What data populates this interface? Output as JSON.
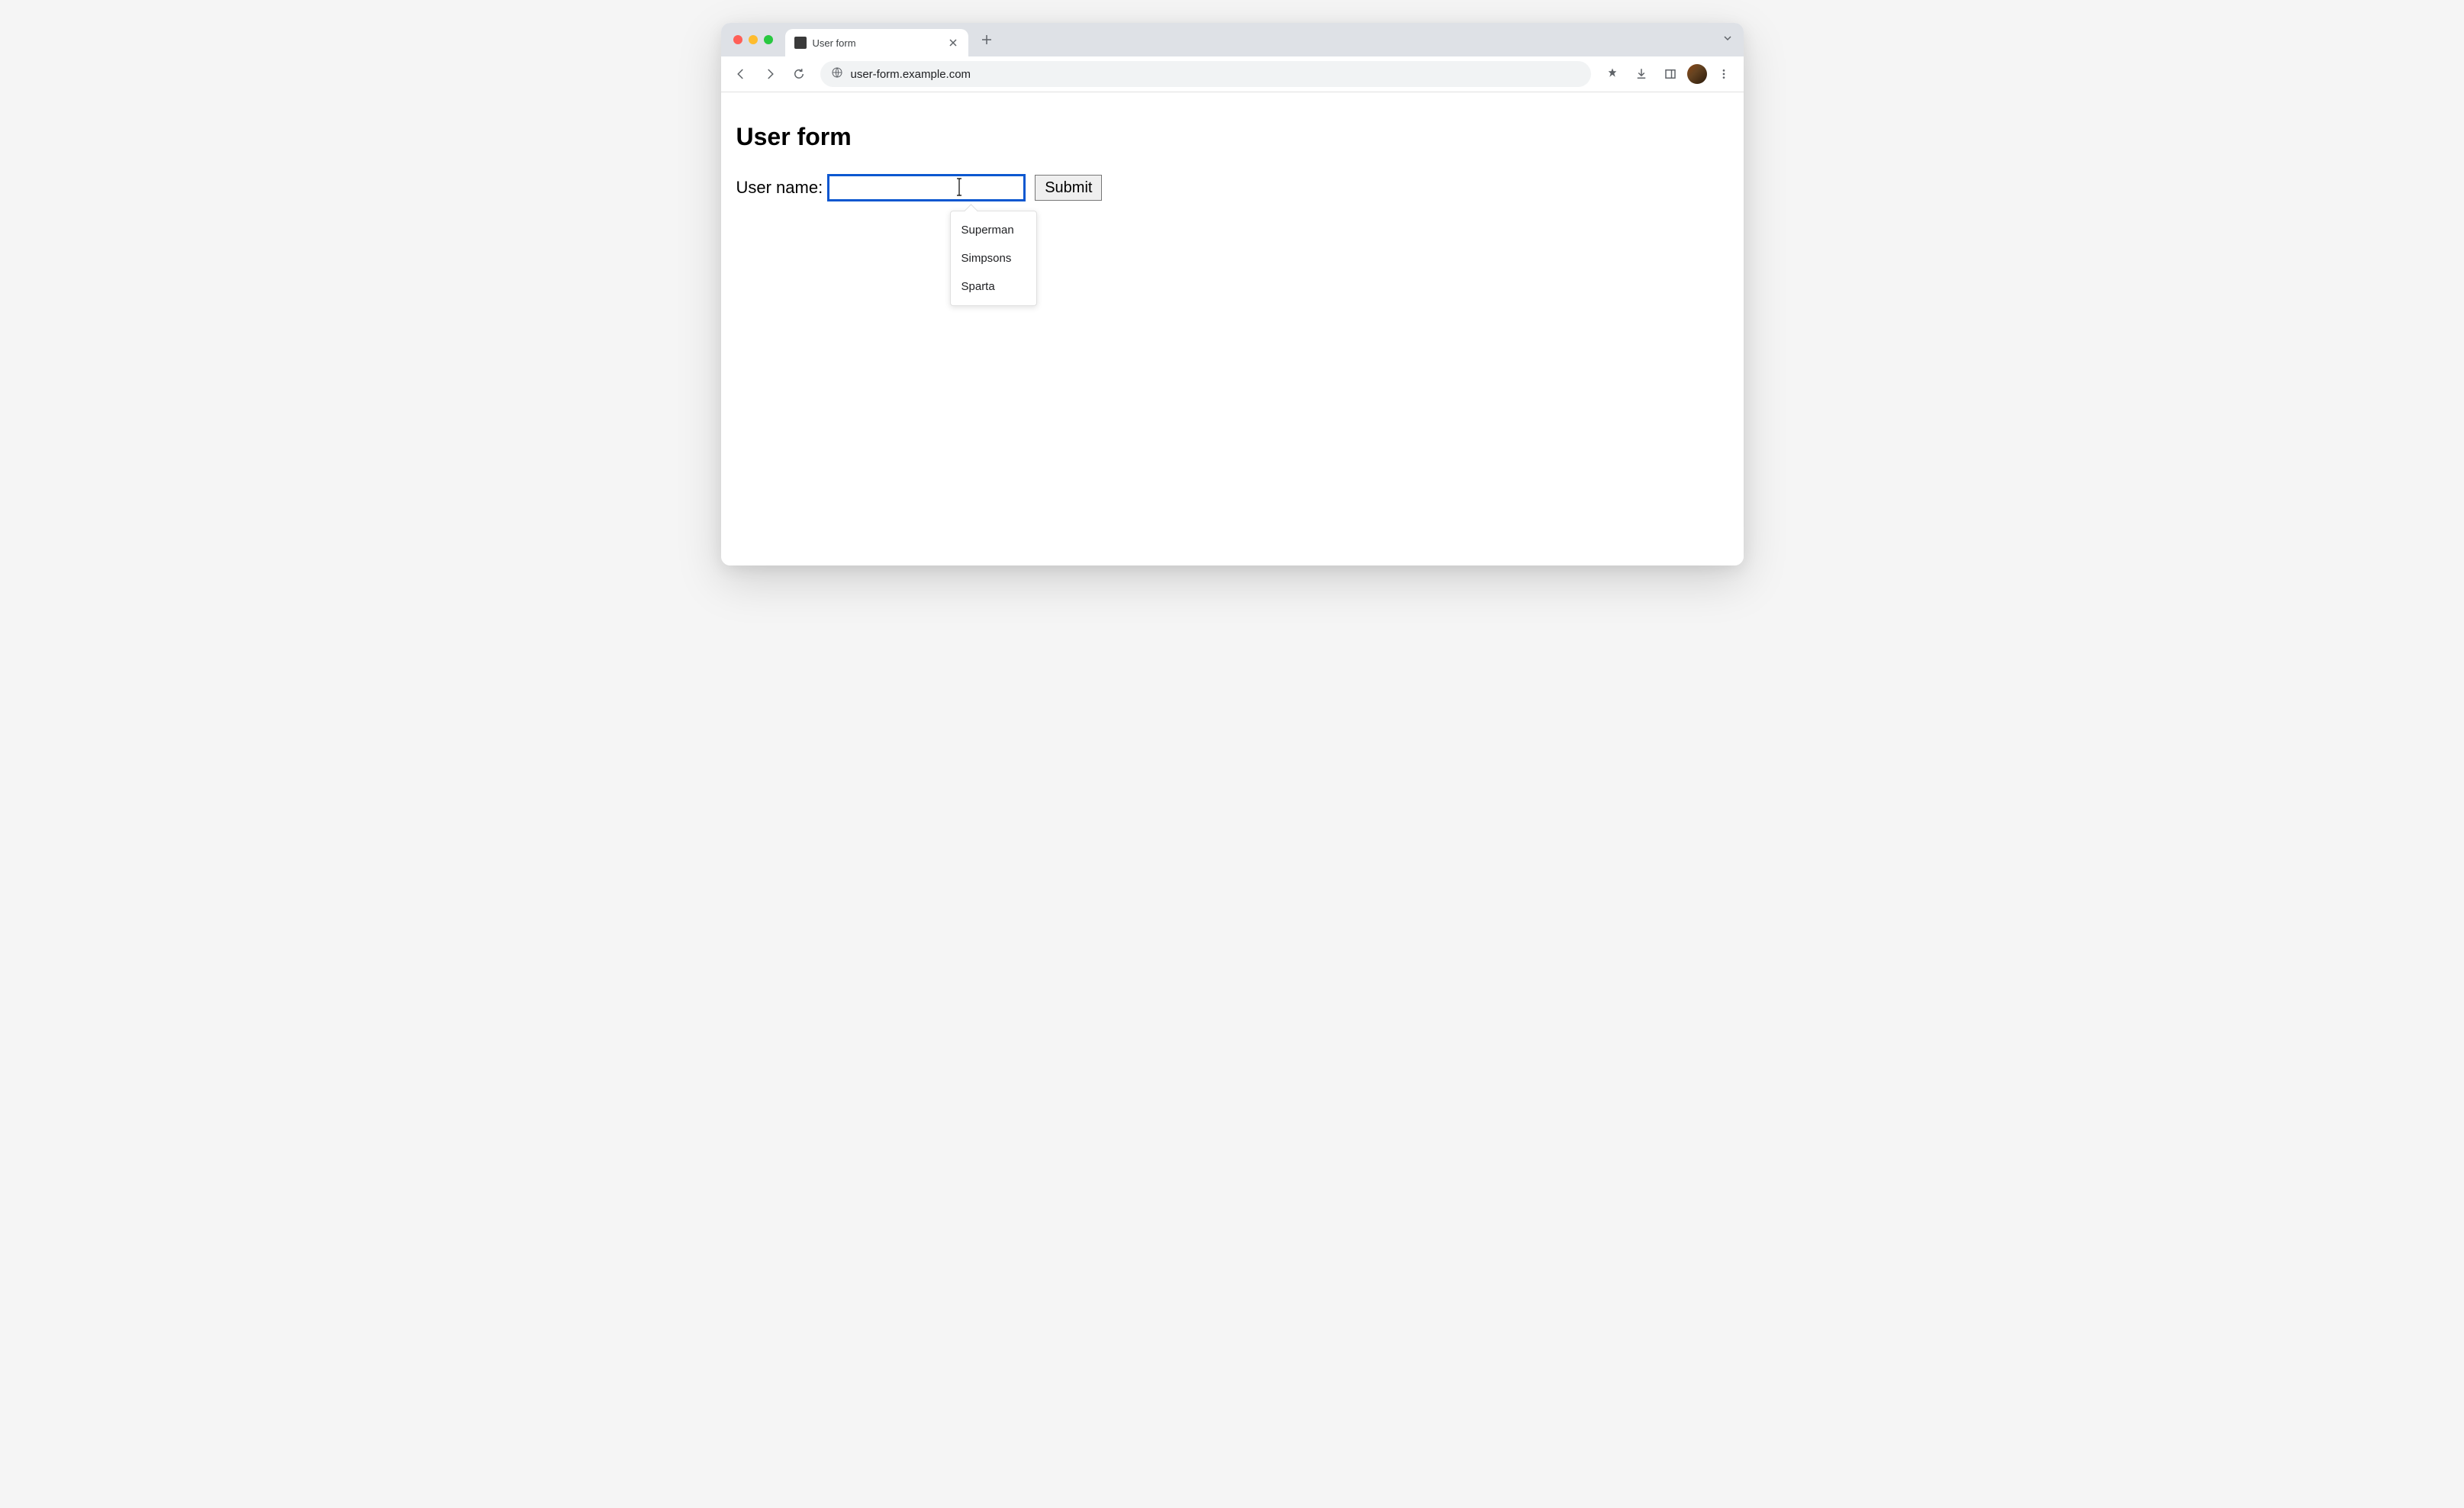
{
  "browser": {
    "tab_title": "User form",
    "url": "user-form.example.com"
  },
  "page": {
    "heading": "User form",
    "form": {
      "username_label": "User name:",
      "username_value": "",
      "submit_label": "Submit"
    },
    "autocomplete": {
      "items": [
        "Superman",
        "Simpsons",
        "Sparta"
      ]
    }
  }
}
